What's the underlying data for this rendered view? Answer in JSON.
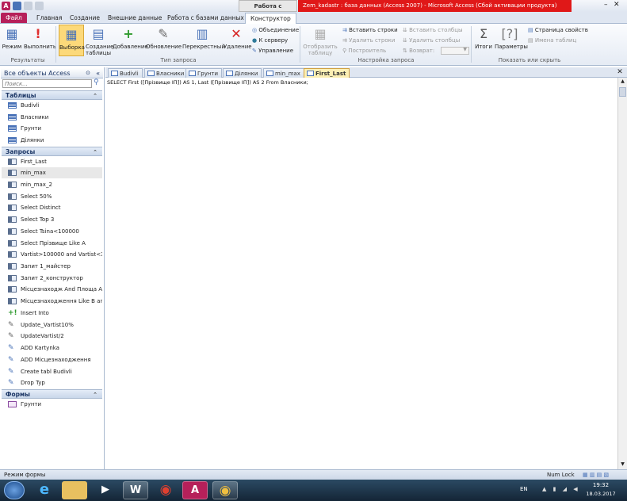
{
  "window": {
    "title": "Zem_kadastr : база данных (Access 2007) - Microsoft Access (Сбой активации продукта)",
    "context_tab": "Работа с запросами"
  },
  "ribbon_tabs": [
    "Файл",
    "Главная",
    "Создание",
    "Внешние данные",
    "Работа с базами данных",
    "Конструктор"
  ],
  "ribbon": {
    "results": {
      "mode": "Режим",
      "run": "Выполнить",
      "group": "Результаты"
    },
    "query_type": {
      "select": "Выборка",
      "make_table": "Создание таблицы",
      "append": "Добавление",
      "update": "Обновление",
      "crosstab": "Перекрестный",
      "delete": "Удаление",
      "union": "Объединение",
      "server": "К серверу",
      "manage": "Управление",
      "group": "Тип запроса"
    },
    "setup": {
      "show_table": "Отобразить таблицу",
      "insert_rows": "Вставить строки",
      "delete_rows": "Удалить строки",
      "builder": "Построитель",
      "insert_cols": "Вставить столбцы",
      "delete_cols": "Удалить столбцы",
      "return": "Возврат:",
      "group": "Настройка запроса"
    },
    "show_hide": {
      "totals": "Итоги",
      "params": "Параметры",
      "props": "Страница свойств",
      "names": "Имена таблиц",
      "group": "Показать или скрыть"
    }
  },
  "nav": {
    "header": "Все объекты Access",
    "search_placeholder": "Поиск...",
    "tables_label": "Таблицы",
    "tables": [
      "Budivli",
      "Власники",
      "Грунти",
      "Ділянки"
    ],
    "queries_label": "Запросы",
    "queries": [
      "First_Last",
      "min_max",
      "min_max_2",
      "Select 50%",
      "Select Distinct",
      "Select Top 3",
      "Select Tsina<100000",
      "Select Прізвище Like A",
      "Vartist>100000 and Vartist<3...",
      "Запит 1_майстер",
      "Запит 2_конструктор",
      "Місцезнаходж And Площа А...",
      "Місцезнаходження Like B an...",
      "Insert Into",
      "Update_Vartist10%",
      "UpdateVartist/2",
      "ADD Kartynka",
      "ADD Місцезнаходження",
      "Create tabl Budivli",
      "Drop Typ"
    ],
    "forms_label": "Формы",
    "forms": [
      "Грунти"
    ]
  },
  "doc_tabs": [
    "Budivli",
    "Власники",
    "Грунти",
    "Ділянки",
    "min_max",
    "First_Last"
  ],
  "sql_text": "SELECT First ([Прізвище ІП]) AS 1, Last ([Прізвище ІП]) AS 2 From Власники;",
  "status": {
    "left": "Режим формы",
    "numlock": "Num Lock"
  },
  "taskbar": {
    "lang": "EN",
    "time": "19:32",
    "date": "18.03.2017"
  },
  "colors": {
    "file_tab": "#b6205a",
    "title_red": "#e01818",
    "accent": "#1d3766"
  }
}
